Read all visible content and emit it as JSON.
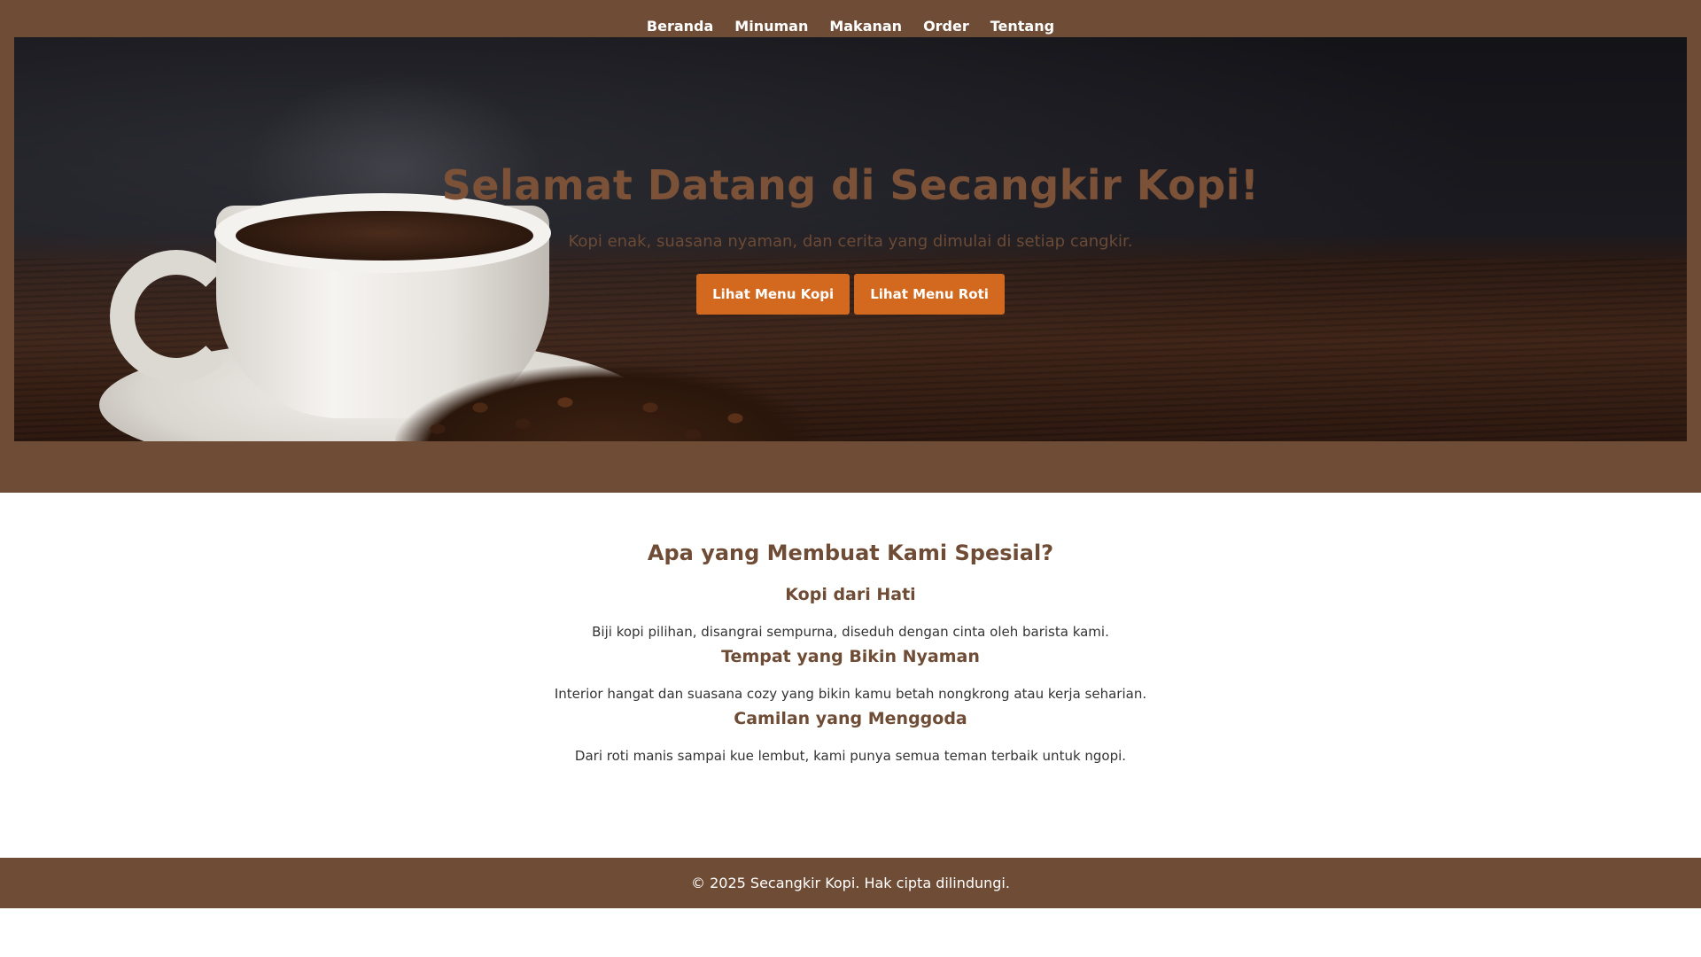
{
  "nav": {
    "items": [
      {
        "label": "Beranda"
      },
      {
        "label": "Minuman"
      },
      {
        "label": "Makanan"
      },
      {
        "label": "Order"
      },
      {
        "label": "Tentang"
      }
    ]
  },
  "hero": {
    "title": "Selamat Datang di Secangkir Kopi!",
    "subtitle": "Kopi enak, suasana nyaman, dan cerita yang dimulai di setiap cangkir.",
    "buttons": [
      {
        "label": "Lihat Menu Kopi"
      },
      {
        "label": "Lihat Menu Roti"
      }
    ]
  },
  "features": {
    "title": "Apa yang Membuat Kami Spesial?",
    "items": [
      {
        "title": "Kopi dari Hati",
        "text": "Biji kopi pilihan, disangrai sempurna, diseduh dengan cinta oleh barista kami."
      },
      {
        "title": "Tempat yang Bikin Nyaman",
        "text": "Interior hangat dan suasana cozy yang bikin kamu betah nongkrong atau kerja seharian."
      },
      {
        "title": "Camilan yang Menggoda",
        "text": "Dari roti manis sampai kue lembut, kami punya semua teman terbaik untuk ngopi."
      }
    ]
  },
  "footer": {
    "text": "© 2025 Secangkir Kopi. Hak cipta dilindungi."
  },
  "colors": {
    "brand_brown": "#6f4c35",
    "accent_orange": "#d2691e"
  }
}
